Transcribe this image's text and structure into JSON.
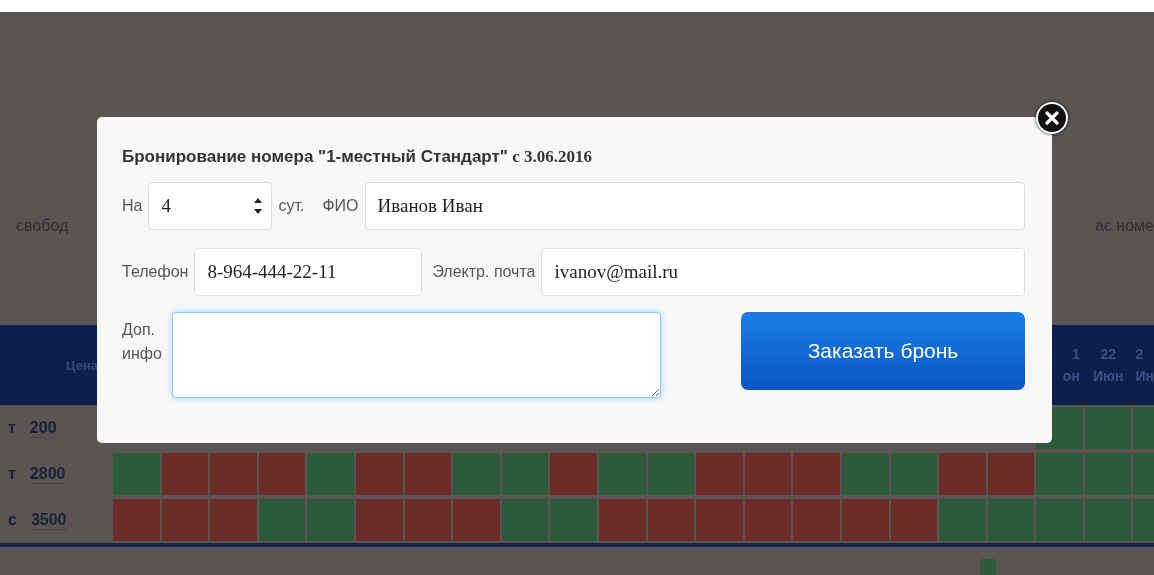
{
  "background": {
    "text_left": "свобод",
    "text_right": "ас номе",
    "table": {
      "price_header": "Цена",
      "date_headers": [
        {
          "day": "1",
          "month": "он"
        },
        {
          "day": "22",
          "month": "Июн"
        },
        {
          "day": "2",
          "month": "Ин"
        }
      ],
      "rows": [
        {
          "label": "т",
          "price": "200",
          "cells": [
            {
              "booked": false
            },
            {
              "booked": false
            },
            {
              "booked": false
            }
          ]
        },
        {
          "label": "т",
          "price": "2800",
          "cells": [
            {
              "booked": false
            },
            {
              "booked": true
            },
            {
              "booked": true
            },
            {
              "booked": true
            },
            {
              "booked": false
            },
            {
              "booked": true
            },
            {
              "booked": true
            },
            {
              "booked": false
            },
            {
              "booked": false
            },
            {
              "booked": true
            },
            {
              "booked": false
            },
            {
              "booked": false
            },
            {
              "booked": true
            },
            {
              "booked": true
            },
            {
              "booked": true
            },
            {
              "booked": false
            },
            {
              "booked": false
            },
            {
              "booked": true
            },
            {
              "booked": true
            },
            {
              "booked": false
            },
            {
              "booked": false
            },
            {
              "booked": false
            }
          ]
        },
        {
          "label": "с",
          "price": "3500",
          "cells": [
            {
              "booked": true
            },
            {
              "booked": true
            },
            {
              "booked": true
            },
            {
              "booked": false
            },
            {
              "booked": false
            },
            {
              "booked": true
            },
            {
              "booked": true
            },
            {
              "booked": true
            },
            {
              "booked": false
            },
            {
              "booked": false
            },
            {
              "booked": true
            },
            {
              "booked": true
            },
            {
              "booked": true
            },
            {
              "booked": true
            },
            {
              "booked": true
            },
            {
              "booked": true
            },
            {
              "booked": true
            },
            {
              "booked": false
            },
            {
              "booked": false
            },
            {
              "booked": false
            },
            {
              "booked": false
            },
            {
              "booked": false
            }
          ]
        }
      ]
    }
  },
  "dialog": {
    "title": "**Бронирование номера \"1-местный Стандарт\"** с 3.06.2016",
    "nights_label": "На",
    "nights": "4",
    "nights_unit": "сут.",
    "name_label": "ФИО",
    "name": "Иванов Иван",
    "phone_label": "Телефон",
    "phone": "8-964-444-22-11",
    "email_label": "Электр. почта",
    "email": "ivanov@mail.ru",
    "info_label_lines": [
      "Доп.",
      "инфо"
    ],
    "submit": "Заказать бронь"
  }
}
